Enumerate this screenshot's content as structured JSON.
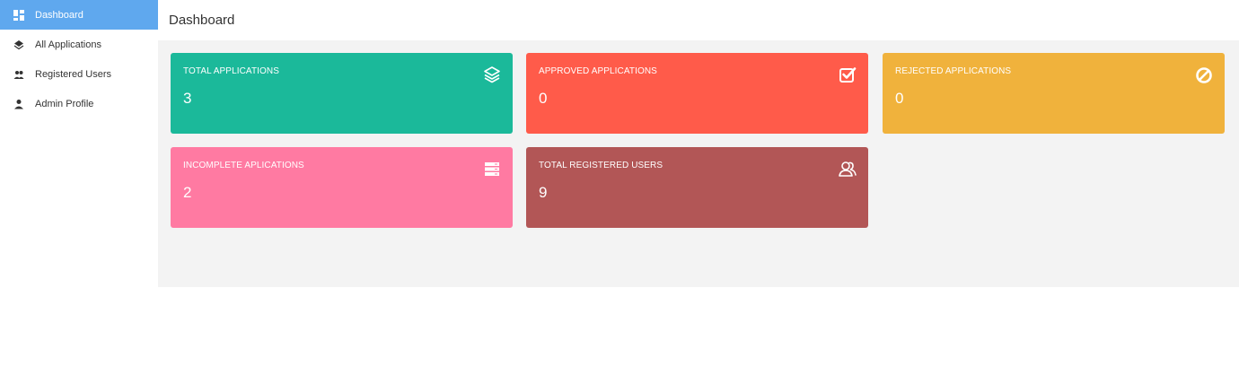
{
  "sidebar": {
    "items": [
      {
        "label": "Dashboard",
        "icon": "dashboard-icon",
        "active": true
      },
      {
        "label": "All Applications",
        "icon": "layers-icon",
        "active": false
      },
      {
        "label": "Registered Users",
        "icon": "users-icon",
        "active": false
      },
      {
        "label": "Admin Profile",
        "icon": "person-icon",
        "active": false
      }
    ]
  },
  "header": {
    "title": "Dashboard"
  },
  "colors": {
    "sidebar_active": "#5fa8ee",
    "total": "#1bb99a",
    "approved": "#ff5b4a",
    "rejected": "#f0b23c",
    "incomplete": "#ff7aa2",
    "users": "#b25656"
  },
  "cards": [
    {
      "label": "TOTAL APPLICATIONS",
      "value": "3",
      "icon": "layers-icon"
    },
    {
      "label": "APPROVED APPLICATIONS",
      "value": "0",
      "icon": "checkbox-icon"
    },
    {
      "label": "REJECTED APPLICATIONS",
      "value": "0",
      "icon": "ban-icon"
    },
    {
      "label": "INCOMPLETE APLICATIONS",
      "value": "2",
      "icon": "server-icon"
    },
    {
      "label": "TOTAL REGISTERED USERS",
      "value": "9",
      "icon": "users-outline-icon"
    }
  ]
}
